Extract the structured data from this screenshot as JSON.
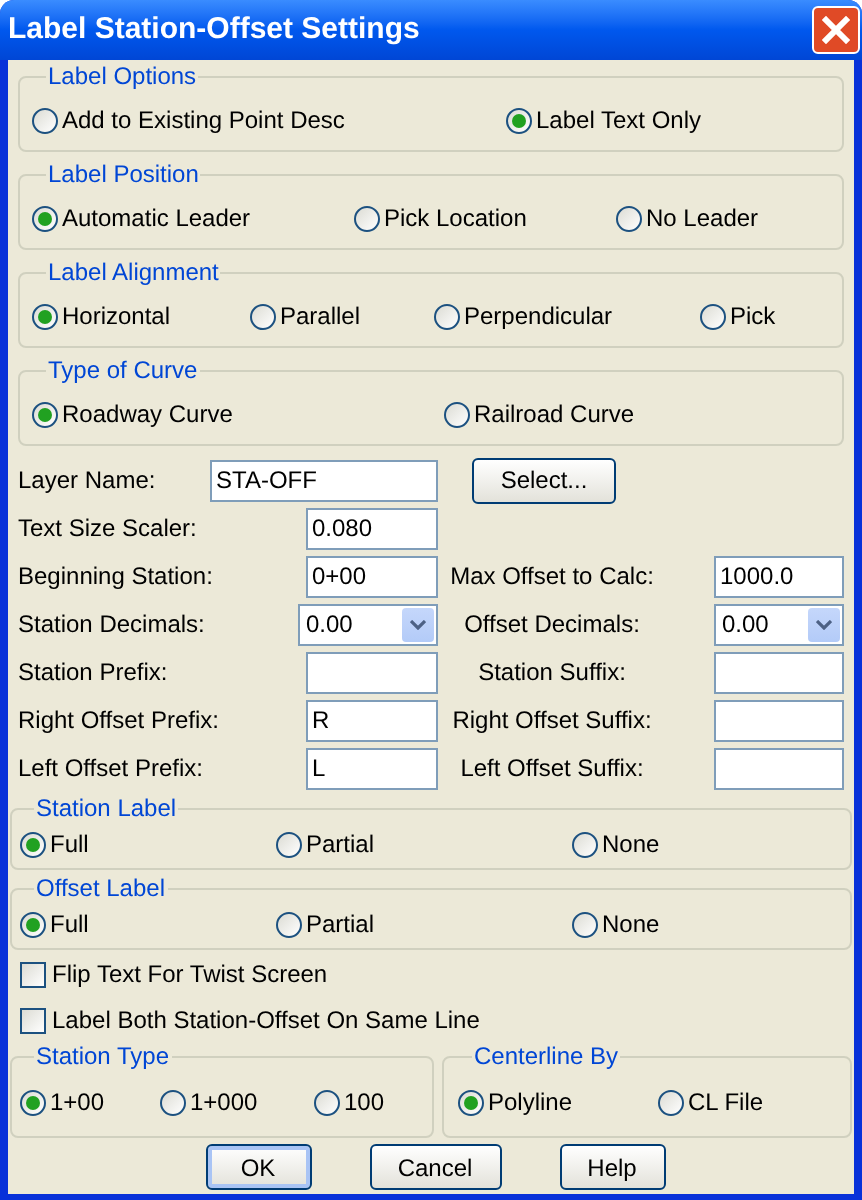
{
  "window": {
    "title": "Label Station-Offset Settings"
  },
  "groups": [
    {
      "title": "Label Options",
      "options": [
        {
          "label": "Add to Existing Point Desc",
          "selected": false
        },
        {
          "label": "Label Text Only",
          "selected": true
        }
      ]
    },
    {
      "title": "Label Position",
      "options": [
        {
          "label": "Automatic Leader",
          "selected": true
        },
        {
          "label": "Pick Location",
          "selected": false
        },
        {
          "label": "No Leader",
          "selected": false
        }
      ]
    },
    {
      "title": "Label Alignment",
      "options": [
        {
          "label": "Horizontal",
          "selected": true
        },
        {
          "label": "Parallel",
          "selected": false
        },
        {
          "label": "Perpendicular",
          "selected": false
        },
        {
          "label": "Pick",
          "selected": false
        }
      ]
    },
    {
      "title": "Type of Curve",
      "options": [
        {
          "label": "Roadway Curve",
          "selected": true
        },
        {
          "label": "Railroad Curve",
          "selected": false
        }
      ]
    }
  ],
  "rows": [
    {
      "left": {
        "kind": "text",
        "label": "Layer Name:",
        "value": "STA-OFF"
      },
      "right": {
        "kind": "button",
        "label": "Select..."
      }
    },
    {
      "left": {
        "kind": "text",
        "label": "Text Size Scaler:",
        "value": "0.080"
      }
    },
    {
      "left": {
        "kind": "text",
        "label": "Beginning Station:",
        "value": "0+00"
      },
      "right": {
        "kind": "text",
        "label": "Max Offset to Calc:",
        "value": "1000.0"
      }
    },
    {
      "left": {
        "kind": "dropdown",
        "label": "Station Decimals:",
        "value": "0.00"
      },
      "right": {
        "kind": "dropdown",
        "label": "Offset Decimals:",
        "value": "0.00"
      }
    },
    {
      "left": {
        "kind": "text",
        "label": "Station Prefix:"
      },
      "right": {
        "kind": "text",
        "label": "Station Suffix:"
      }
    },
    {
      "left": {
        "kind": "text",
        "label": "Right Offset Prefix:",
        "value": "R"
      },
      "right": {
        "kind": "text",
        "label": "Right Offset Suffix:"
      }
    },
    {
      "left": {
        "kind": "text",
        "label": "Left Offset Prefix:",
        "value": "L"
      },
      "right": {
        "kind": "text",
        "label": "Left Offset Suffix:"
      }
    }
  ],
  "label_groups": [
    {
      "title": "Station Label",
      "options": [
        {
          "label": "Full",
          "selected": true
        },
        {
          "label": "Partial",
          "selected": false
        },
        {
          "label": "None",
          "selected": false
        }
      ]
    },
    {
      "title": "Offset Label",
      "options": [
        {
          "label": "Full",
          "selected": true
        },
        {
          "label": "Partial",
          "selected": false
        },
        {
          "label": "None",
          "selected": false
        }
      ]
    }
  ],
  "checkboxes": [
    {
      "label": "Flip Text For Twist Screen",
      "checked": false
    },
    {
      "label": "Label Both Station-Offset On Same Line",
      "checked": false
    }
  ],
  "bottom_groups": [
    {
      "title": "Station Type",
      "options": [
        {
          "label": "1+00",
          "selected": true
        },
        {
          "label": "1+000",
          "selected": false
        },
        {
          "label": "100",
          "selected": false
        }
      ]
    },
    {
      "title": "Centerline By",
      "options": [
        {
          "label": "Polyline",
          "selected": true
        },
        {
          "label": "CL File",
          "selected": false
        }
      ]
    }
  ],
  "buttons": [
    {
      "label": "OK",
      "default": true
    },
    {
      "label": "Cancel",
      "default": false
    },
    {
      "label": "Help",
      "default": false
    }
  ]
}
